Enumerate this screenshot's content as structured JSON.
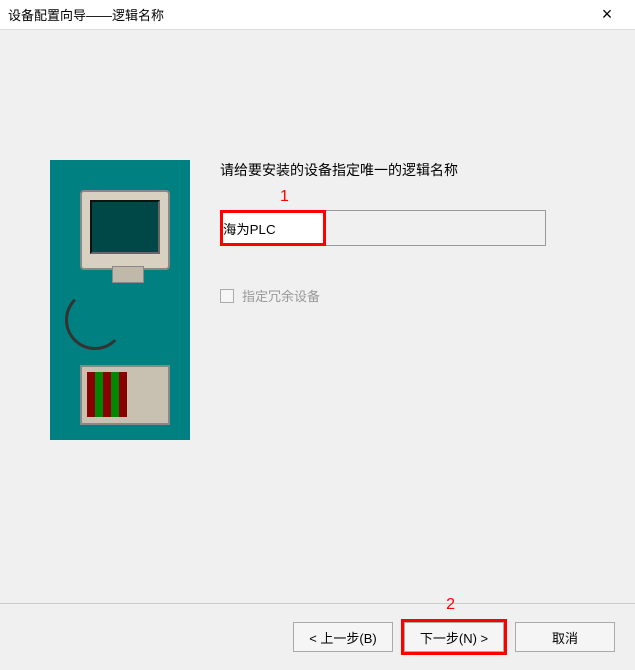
{
  "titlebar": {
    "title": "设备配置向导——逻辑名称",
    "close": "×"
  },
  "form": {
    "prompt": "请给要安装的设备指定唯一的逻辑名称",
    "name_value": "海为PLC",
    "redundant_label": "指定冗余设备"
  },
  "markers": {
    "m1": "1",
    "m2": "2"
  },
  "footer": {
    "back": "< 上一步(B)",
    "next": "下一步(N) >",
    "cancel": "取消"
  }
}
